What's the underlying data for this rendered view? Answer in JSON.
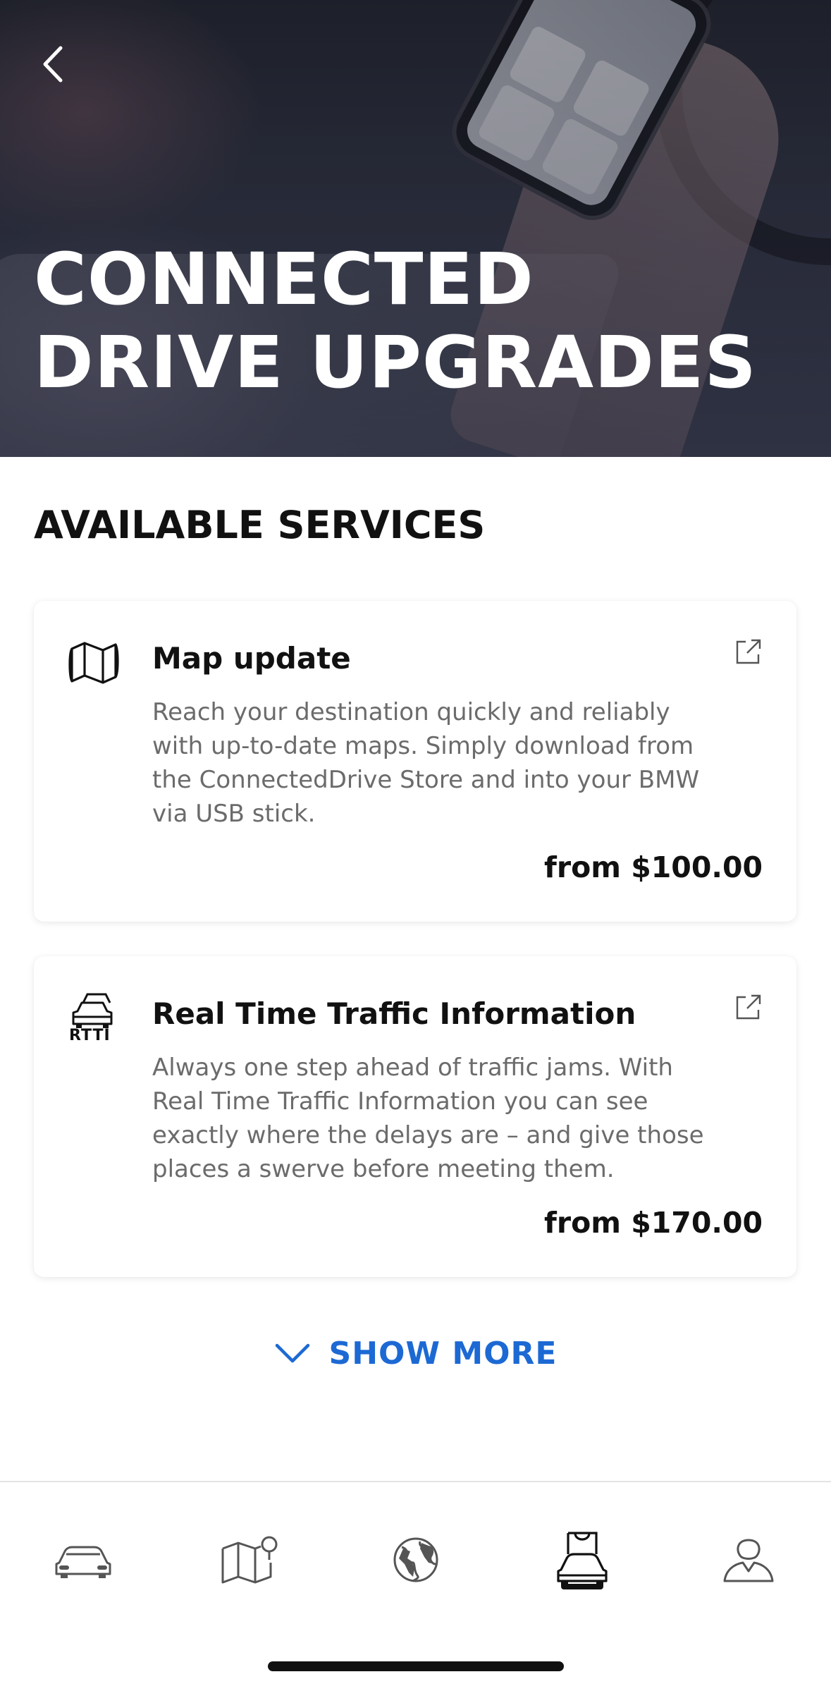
{
  "hero": {
    "title_line_1": "CONNECTED",
    "title_line_2": "DRIVE UPGRADES",
    "back_icon": "chevron-left-icon"
  },
  "section": {
    "heading": "AVAILABLE SERVICES"
  },
  "services": [
    {
      "icon": "map-icon",
      "title": "Map update",
      "description": "Reach your destination quickly and reliably with up-to-date maps. Simply download from the ConnectedDrive Store and into your BMW via USB stick.",
      "price": "from $100.00",
      "link_icon": "external-link-icon"
    },
    {
      "icon": "traffic-cars-icon",
      "icon_label": "RTTI",
      "title": "Real Time Traffic Information",
      "description": "Always one step ahead of traffic jams. With Real Time Traffic Information you can see exactly where the delays are – and give those places a swerve before meeting them.",
      "price": "from $170.00",
      "link_icon": "external-link-icon"
    }
  ],
  "show_more": {
    "label": "SHOW MORE",
    "icon": "chevron-down-icon"
  },
  "bottom_nav": {
    "items": [
      {
        "icon": "car-icon",
        "active": false
      },
      {
        "icon": "map-pin-icon",
        "active": false
      },
      {
        "icon": "globe-icon",
        "active": false
      },
      {
        "icon": "shop-car-icon",
        "active": true
      },
      {
        "icon": "profile-icon",
        "active": false
      }
    ]
  },
  "colors": {
    "accent": "#1c69d4",
    "text_primary": "#111111",
    "text_secondary": "#6b6b6b"
  }
}
